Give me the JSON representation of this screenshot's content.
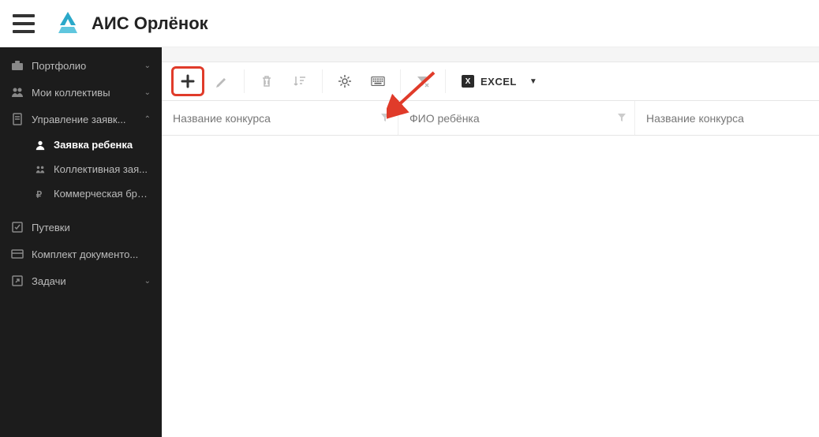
{
  "header": {
    "title": "АИС Орлёнок"
  },
  "sidebar": {
    "portfolio": "Портфолио",
    "collectives": "Мои коллективы",
    "applications": "Управление заявк...",
    "child_app": "Заявка ребенка",
    "collective_app": "Коллективная зая...",
    "commercial_app": "Коммерческая бро...",
    "vouchers": "Путевки",
    "docs": "Комплект документо...",
    "tasks": "Задачи"
  },
  "toolbar": {
    "export_label": "EXCEL"
  },
  "columns": {
    "c1": "Название конкурса",
    "c2": "ФИО ребёнка",
    "c3": "Название конкурса"
  }
}
